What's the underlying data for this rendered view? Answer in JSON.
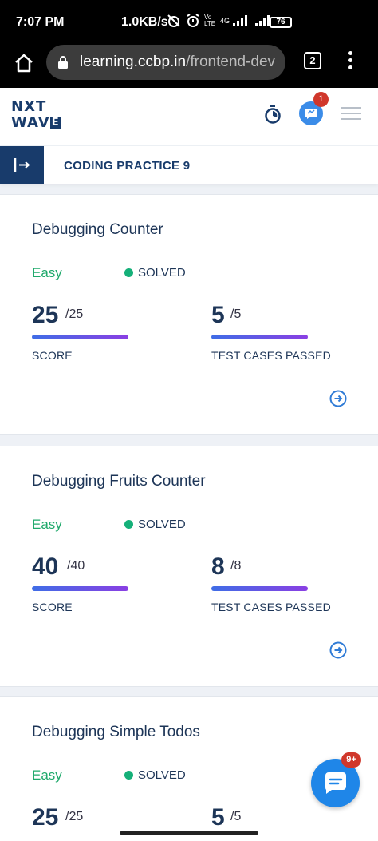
{
  "status_bar": {
    "time": "7:07 PM",
    "network_speed": "1.0KB/s",
    "network_type": "4G",
    "volte": "Vo LTE",
    "battery": "76"
  },
  "browser": {
    "url_host": "learning.ccbp.in",
    "url_path": "/frontend-dev",
    "tab_count": "2"
  },
  "app_header": {
    "logo_top": "NXT",
    "logo_bottom": "WAV",
    "logo_e": "E",
    "notification_count": "1"
  },
  "practice": {
    "title": "CODING PRACTICE 9"
  },
  "cards": [
    {
      "title": "Debugging Counter",
      "difficulty": "Easy",
      "status": "SOLVED",
      "score": "25",
      "score_total": "/25",
      "score_label": "SCORE",
      "tests": "5",
      "tests_total": "/5",
      "tests_label": "TEST CASES PASSED",
      "score_progress": 1.0,
      "tests_progress": 1.0
    },
    {
      "title": "Debugging Fruits Counter",
      "difficulty": "Easy",
      "status": "SOLVED",
      "score": "40",
      "score_total": "/40",
      "score_label": "SCORE",
      "tests": "8",
      "tests_total": "/8",
      "tests_label": "TEST CASES PASSED",
      "score_progress": 1.0,
      "tests_progress": 1.0
    },
    {
      "title": "Debugging Simple Todos",
      "difficulty": "Easy",
      "status": "SOLVED",
      "score": "25",
      "score_total": "/25",
      "tests": "5",
      "tests_total": "/5"
    }
  ],
  "chat_fab": {
    "badge": "9+"
  },
  "colors": {
    "primary": "#183b6b",
    "easy": "#1fa96b",
    "solved": "#15b079",
    "badge": "#d0372b",
    "fab": "#1f86e8"
  }
}
